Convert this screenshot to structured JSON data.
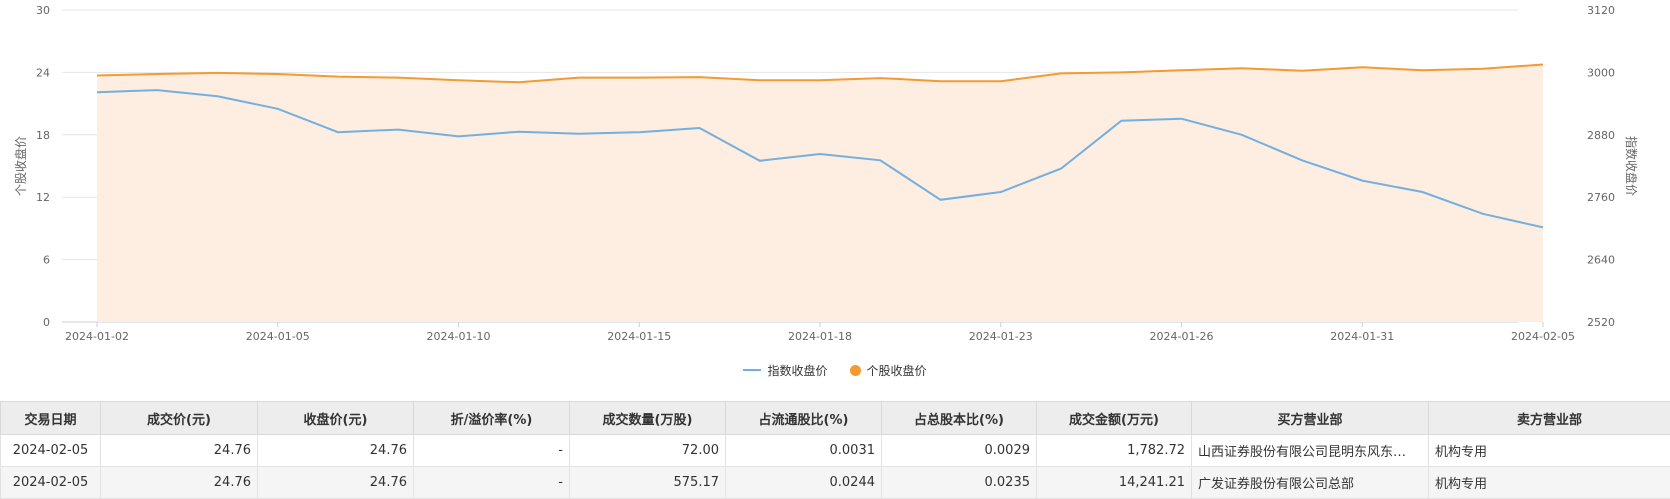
{
  "chart_data": {
    "type": "line",
    "dates": [
      "2024-01-02",
      "2024-01-03",
      "2024-01-04",
      "2024-01-05",
      "2024-01-08",
      "2024-01-09",
      "2024-01-10",
      "2024-01-11",
      "2024-01-12",
      "2024-01-15",
      "2024-01-16",
      "2024-01-17",
      "2024-01-18",
      "2024-01-19",
      "2024-01-22",
      "2024-01-23",
      "2024-01-24",
      "2024-01-25",
      "2024-01-26",
      "2024-01-29",
      "2024-01-30",
      "2024-01-31",
      "2024-02-01",
      "2024-02-02",
      "2024-02-05"
    ],
    "x_tick_labels": [
      "2024-01-02",
      "2024-01-05",
      "2024-01-10",
      "2024-01-15",
      "2024-01-18",
      "2024-01-23",
      "2024-01-26",
      "2024-01-31",
      "2024-02-05"
    ],
    "series": [
      {
        "name": "指数收盘价",
        "axis": "right",
        "color": "#74afde",
        "values": [
          2962,
          2966,
          2954,
          2930,
          2885,
          2890,
          2877,
          2886,
          2882,
          2885,
          2893,
          2830,
          2843,
          2831,
          2755,
          2770,
          2815,
          2907,
          2911,
          2880,
          2831,
          2792,
          2770,
          2728,
          2702
        ]
      },
      {
        "name": "个股收盘价",
        "axis": "left",
        "color": "#f39a32",
        "values": [
          23.7,
          23.85,
          23.95,
          23.85,
          23.6,
          23.5,
          23.25,
          23.05,
          23.5,
          23.5,
          23.55,
          23.25,
          23.25,
          23.45,
          23.15,
          23.15,
          23.9,
          24.0,
          24.2,
          24.4,
          24.15,
          24.5,
          24.2,
          24.35,
          24.76
        ]
      }
    ],
    "yLeft": {
      "label": "个股收盘价",
      "min": 0,
      "max": 30,
      "ticks": [
        "0",
        "6",
        "12",
        "18",
        "24",
        "30"
      ]
    },
    "yRight": {
      "label": "指数收盘价",
      "min": 2520,
      "max": 3120,
      "ticks": [
        "2520",
        "2640",
        "2760",
        "2880",
        "3000",
        "3120"
      ]
    },
    "grid": true,
    "legend_position": "bottom-center",
    "area_fill": "#fdeee1"
  },
  "table": {
    "headers": [
      "交易日期",
      "成交价(元)",
      "收盘价(元)",
      "折/溢价率(%)",
      "成交数量(万股)",
      "占流通股比(%)",
      "占总股本比(%)",
      "成交金额(万元)",
      "买方营业部",
      "卖方营业部"
    ],
    "rows": [
      [
        "2024-02-05",
        "24.76",
        "24.76",
        "-",
        "72.00",
        "0.0031",
        "0.0029",
        "1,782.72",
        "山西证券股份有限公司昆明东风东…",
        "机构专用"
      ],
      [
        "2024-02-05",
        "24.76",
        "24.76",
        "-",
        "575.17",
        "0.0244",
        "0.0235",
        "14,241.21",
        "广发证券股份有限公司总部",
        "机构专用"
      ]
    ]
  }
}
